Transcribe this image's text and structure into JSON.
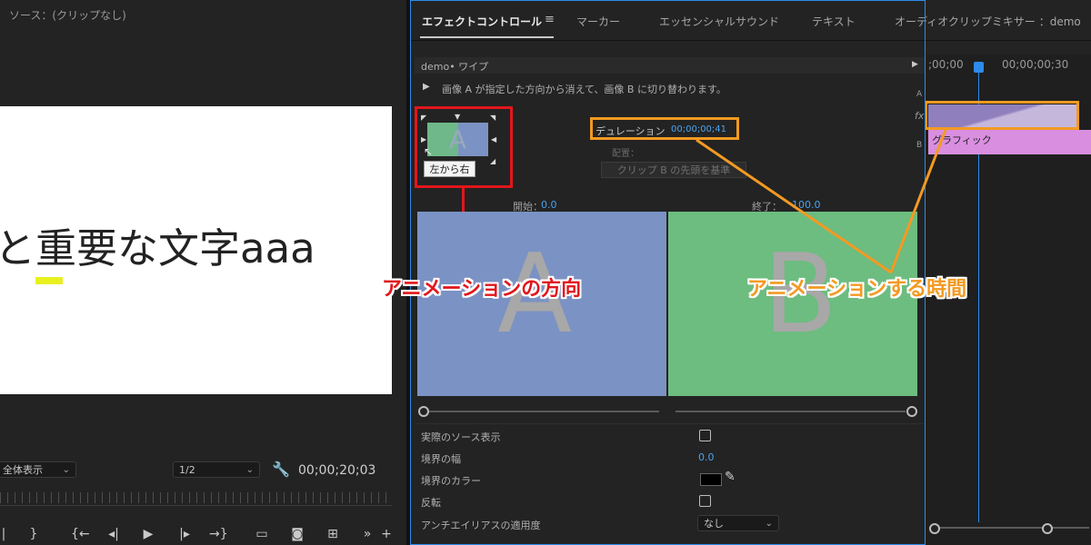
{
  "source_monitor": {
    "title": "ソース：(クリップなし)",
    "frame_text": "と重要な文字aaa",
    "zoom_value": "全体表示",
    "resolution_value": "1/2",
    "timecode": "00;00;20;03"
  },
  "transport_icons": [
    "mark-out-icon",
    "step-back-icon",
    "play-icon",
    "step-forward-icon",
    "go-to-out-icon",
    "safe-margins-icon",
    "camera-icon",
    "export-frame-icon",
    "more-icon",
    "add-icon"
  ],
  "effect_panel": {
    "tabs": [
      "エフェクトコントロール",
      "マーカー",
      "エッセンシャルサウンド",
      "テキスト",
      "オーディオクリップミキサー ：demo"
    ],
    "menu_icon": "≡",
    "breadcrumb": "demo• ワイプ",
    "description": "画像 A が指定した方向から消えて、画像 B に切り替わります。",
    "thumb_letter": "A",
    "tooltip": "左から右",
    "duration_label": "デュレーション",
    "duration_value": "00;00;00;41",
    "alignment_label": "配置：",
    "alignment_value": "クリップ B の先頭を基準",
    "start_label": "開始：",
    "start_value": "0.0",
    "end_label": "終了：",
    "end_value": "100.0",
    "preview_a": "A",
    "preview_b": "B",
    "params": [
      {
        "label": "実際のソース表示"
      },
      {
        "label": "境界の幅",
        "value": "0.0"
      },
      {
        "label": "境界のカラー"
      },
      {
        "label": "反転"
      },
      {
        "label": "アンチエイリアスの適用度",
        "value": "なし"
      }
    ]
  },
  "annotations": {
    "red_label": "アニメーションの方向",
    "orange_label": "アニメーションする時間",
    "red_color": "#e2161c",
    "orange_color": "#f39a22"
  },
  "timeline": {
    "time_start": ";00;00",
    "time_end": "00;00;00;30",
    "track_a": "A",
    "track_b": "B",
    "fx": "fx",
    "clip_label": "グラフィック"
  },
  "colors": {
    "accent": "#2d8ceb",
    "preview_a": "#7b92c4",
    "preview_b": "#6dbc80",
    "clip": "#d98ee0"
  }
}
